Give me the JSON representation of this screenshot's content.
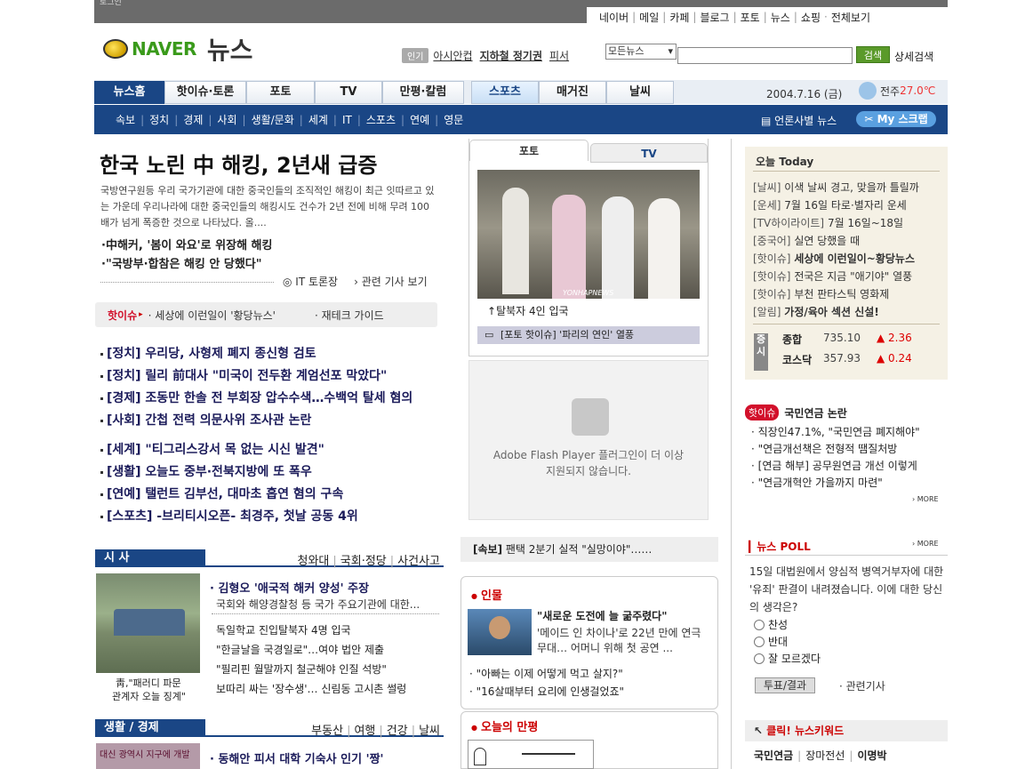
{
  "top": {
    "login": "로그인",
    "menu": [
      "네이버",
      "메일",
      "카페",
      "블로그",
      "포토",
      "뉴스",
      "쇼핑",
      "전체보기"
    ]
  },
  "logo": {
    "brand": "NAVER",
    "section": "뉴스"
  },
  "popular": {
    "tag": "인기",
    "items": [
      "아시안컵",
      "지하철 정기권",
      "피서"
    ]
  },
  "search": {
    "select": "모든뉴스",
    "button": "검색",
    "advanced": "상세검색"
  },
  "nav": {
    "tabs": [
      "뉴스홈",
      "핫이슈·토론",
      "포토",
      "TV",
      "만평·칼럼",
      "스포츠",
      "매거진",
      "날씨"
    ],
    "date": "2004.7.16 (금)",
    "weather_city": "전주",
    "weather_temp": "27.0℃"
  },
  "subnav": {
    "items": [
      "속보",
      "정치",
      "경제",
      "사회",
      "생활/문화",
      "세계",
      "IT",
      "스포츠",
      "연예",
      "영문"
    ],
    "right": "언론사별 뉴스",
    "myscrap": "My 스크랩"
  },
  "headline": {
    "title": "한국 노린 中 해킹, 2년새 급증",
    "summary": "국방연구원등 우리 국가기관에 대한 중국인들의 조직적인 해킹이 최근 잇따르고 있는 가운데 우리나라에 대한 중국인들의 해킹시도 건수가 2년 전에 비해 무려 100배가 넘게 폭증한 것으로 나타났다. 올....",
    "subs": [
      "中해커, '봄이 와요'로 위장해 해킹",
      "\"국방부·합참은 해킹 안 당했다\""
    ],
    "tool1": "IT 토론장",
    "tool2": "관련 기사 보기"
  },
  "issuebar": {
    "label": "핫이슈",
    "item1": "세상에 이런일이 '황당뉴스'",
    "item2": "재테크 가이드"
  },
  "news": [
    "[정치] 우리당, 사형제 폐지 종신형 검토",
    "[정치] 릴리 前대사 \"미국이 전두환 계엄선포 막았다\"",
    "[경제] 조동만 한솔 전 부회장 압수수색…수백억 탈세 혐의",
    "[사회] 간첩 전력 의문사위 조사관 논란",
    "[세계] \"티그리스강서 목 없는 시신 발견\"",
    "[생활] 오늘도 중부·전북지방에 또 폭우",
    "[연예] 탤런트 김부선, 대마초 흡연 혐의 구속",
    "[스포츠] -브리티시오픈- 최경주, 첫날 공동 4위"
  ],
  "sisa": {
    "label": "시 사",
    "tabs": [
      "청와대",
      "국회·정당",
      "사건사고"
    ],
    "photo_caption1": "靑,\"패러디 파문",
    "photo_caption2": "관계자 오늘 징계\"",
    "lead_title": "김형오 '애국적 해커 양성' 주장",
    "lead_sub": "국회와 해양경찰청 등 국가 주요기관에 대한...",
    "items": [
      "독일학교 진입탈북자 4명 입국",
      "\"한글날을 국경일로\"…여야 법안 제출",
      "\"필리핀 월말까지 철군해야 인질 석방\"",
      "보따리 싸는 '장수생'… 신림동 고시촌 썰렁"
    ]
  },
  "life": {
    "label": "생활 / 경제",
    "tabs": [
      "부동산",
      "여행",
      "건강",
      "날씨"
    ],
    "lead_title": "동해안 피서 대학 기숙사 인기 '짱'",
    "photo_text": "대신 광역시 지구에 개발"
  },
  "photo": {
    "tab_photo": "포토",
    "tab_tv": "TV",
    "watermark": "YONHAPNEWS",
    "caption": "탈북자 4인 입국",
    "bar": "[포토 핫이슈] '파리의 연인' 열풍"
  },
  "flash": {
    "text1": "Adobe Flash Player 플러그인이 더 이상",
    "text2": "지원되지 않습니다."
  },
  "breaking": {
    "label": "[속보]",
    "text": "팬택 2분기 실적 \"실망이야\"……"
  },
  "people": {
    "title": "인물",
    "headline": "\"새로운 도전에 늘 굶주렸다\"",
    "desc1": "'메이드 인 차이나'로 22년 만에 연극",
    "desc2": "무대… 어머니 위해 첫 공연 ...",
    "items": [
      "\"아빠는 이제 어떻게 먹고 살지?\"",
      "\"16살때부터 요리에 인생걸었죠\""
    ]
  },
  "cartoon": {
    "title": "오늘의 만평"
  },
  "today": {
    "title": "오늘 Today",
    "items": [
      {
        "cat": "[날씨]",
        "text": "이색 날씨 경고, 맞을까 틀릴까"
      },
      {
        "cat": "[운세]",
        "text": "7월 16일 타로·별자리 운세"
      },
      {
        "cat": "[TV하이라이트]",
        "text": "7월 16일~18일"
      },
      {
        "cat": "[중국어]",
        "text": "실연 당했을 때"
      },
      {
        "cat": "[핫이슈]",
        "text": "세상에 이런일이~황당뉴스"
      },
      {
        "cat": "[핫이슈]",
        "text": "전국은 지금 \"애기야\" 열풍"
      },
      {
        "cat": "[핫이슈]",
        "text": "부천 판타스틱 영화제"
      },
      {
        "cat": "[알림]",
        "text": "가정/육아 섹션 신설!"
      }
    ],
    "stock_label": "증시",
    "stocks": [
      {
        "name": "종합",
        "value": "735.10",
        "change": "▲ 2.36"
      },
      {
        "name": "코스닥",
        "value": "357.93",
        "change": "▲ 0.24"
      }
    ]
  },
  "pension": {
    "tag": "핫이슈",
    "title": "국민연금 논란",
    "items": [
      "직장인47.1%, \"국민연금 폐지해야\"",
      "\"연금개선책은 전형적 땜질처방",
      "[연금 해부] 공무원연금 개선 이렇게",
      "\"연금개혁안 가을까지 마련\""
    ],
    "more": "MORE"
  },
  "poll": {
    "title": "뉴스 POLL",
    "more": "MORE",
    "question": "15일 대법원에서 양심적 병역거부자에 대한 '유죄' 판결이 내려졌습니다. 이에 대한 당신의 생각은?",
    "options": [
      "찬성",
      "반대",
      "잘 모르겠다"
    ],
    "vote": "투표/결과",
    "related": "관련기사"
  },
  "keyword": {
    "title": "클릭! 뉴스키워드",
    "items": [
      "국민연금",
      "장마전선",
      "이명박"
    ]
  },
  "colors": {
    "brand_green": "#3a9a1b",
    "nav_blue": "#1a4685",
    "hot_red": "#d2102b"
  }
}
